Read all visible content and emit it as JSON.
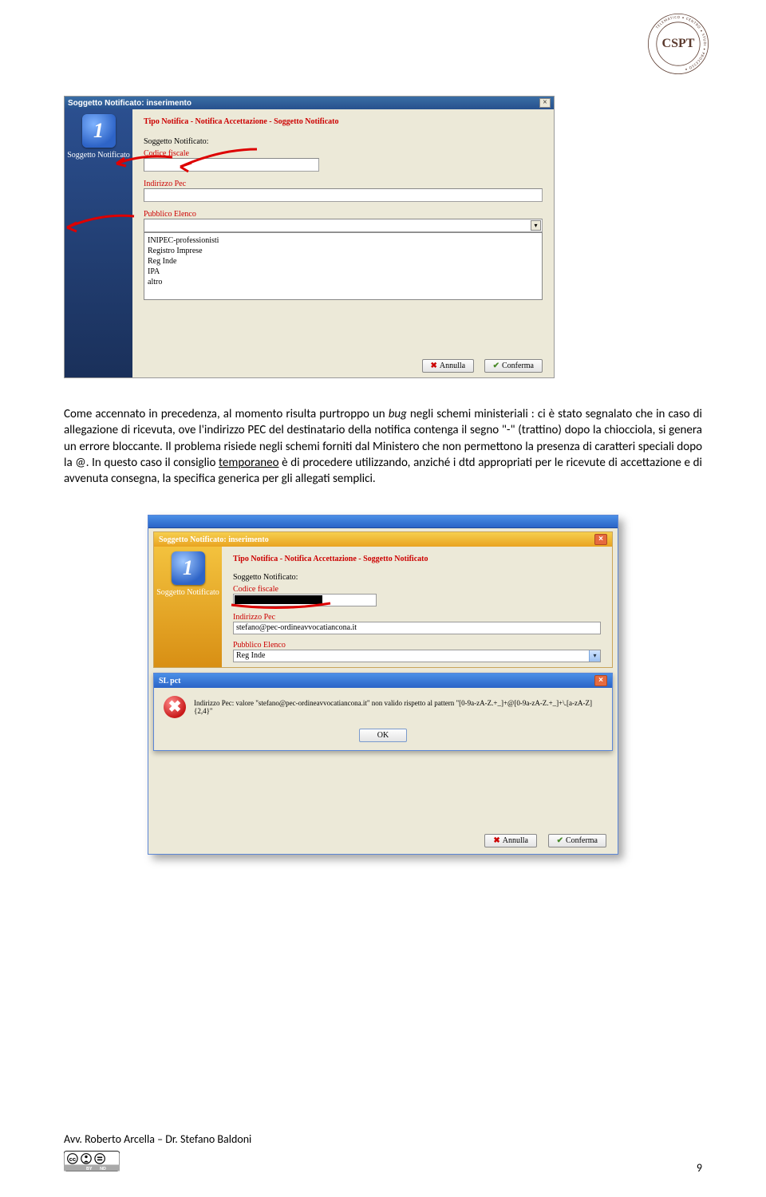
{
  "logo": {
    "top": "CENTRO",
    "right": "STUDI",
    "bottom": "PROCESSO",
    "left": "TELEMATICO",
    "mono": "CSPT"
  },
  "shot1": {
    "title": "Soggetto Notificato: inserimento",
    "side_num": "1",
    "side_lbl": "Soggetto Notificato",
    "header": "Tipo Notifica - Notifica Accettazione - Soggetto Notificato",
    "sogg_lbl": "Soggetto Notificato:",
    "cf_lbl": "Codice fiscale",
    "pec_lbl": "Indirizzo Pec",
    "elenco_lbl": "Pubblico Elenco",
    "list": [
      "INIPEC-professionisti",
      "Registro Imprese",
      "Reg Inde",
      "IPA",
      "altro"
    ],
    "btn_cancel": "Annulla",
    "btn_ok": "Conferma"
  },
  "para": {
    "t1": "Come accennato in precedenza, al momento risulta purtroppo un ",
    "bug": "bug",
    "t2": " negli schemi ministeriali : ci è stato segnalato che in caso di allegazione di ricevuta, ove l'indirizzo PEC del destinatario della notifica contenga il segno \"-\" (trattino) dopo la chiocciola, si genera un errore bloccante. Il problema risiede negli schemi forniti dal Ministero che non permettono la presenza di caratteri speciali dopo la @. In questo caso il consiglio ",
    "temp": "temporaneo",
    "t3": " è di  procedere utilizzando, anziché i dtd appropriati per le ricevute di accettazione e di avvenuta consegna, la specifica generica per gli allegati semplici."
  },
  "shot2": {
    "wtitle": "Soggetto Notificato: inserimento",
    "side_num": "1",
    "side_lbl": "Soggetto Notificato",
    "header": "Tipo Notifica - Notifica Accettazione - Soggetto Notificato",
    "sogg_lbl": "Soggetto Notificato:",
    "cf_lbl": "Codice fiscale",
    "pec_lbl": "Indirizzo Pec",
    "pec_val": "stefano@pec-ordineavvocatiancona.it",
    "elenco_lbl": "Pubblico Elenco",
    "elenco_val": "Reg Inde",
    "err_title": "SL pct",
    "err_msg": "Indirizzo Pec: valore \"stefano@pec-ordineavvocatiancona.it\" non valido rispetto al pattern \"[0-9a-zA-Z.+_]+@[0-9a-zA-Z.+_]+\\.[a-zA-Z]{2,4}\"",
    "ok": "OK",
    "btn_cancel": "Annulla",
    "btn_ok": "Conferma"
  },
  "footer": {
    "authors": "Avv. Roberto Arcella – Dr. Stefano Baldoni",
    "page": "9"
  }
}
